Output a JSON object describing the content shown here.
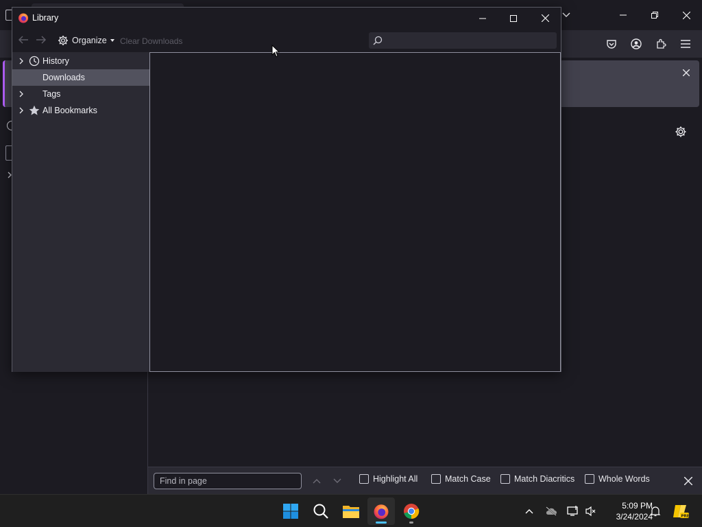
{
  "background_browser": {
    "notice_close_icon": "close-icon",
    "findbar": {
      "placeholder": "Find in page",
      "options": [
        {
          "label": "Highlight All",
          "checked": false
        },
        {
          "label": "Match Case",
          "checked": false
        },
        {
          "label": "Match Diacritics",
          "checked": false
        },
        {
          "label": "Whole Words",
          "checked": false
        }
      ]
    }
  },
  "library": {
    "title": "Library",
    "toolbar": {
      "organize_label": "Organize",
      "clear_label": "Clear Downloads",
      "search_placeholder": ""
    },
    "tree": [
      {
        "label": "History",
        "icon": "clock-icon",
        "expandable": true,
        "selected": false
      },
      {
        "label": "Downloads",
        "icon": "",
        "expandable": false,
        "selected": true
      },
      {
        "label": "Tags",
        "icon": "",
        "expandable": true,
        "selected": false
      },
      {
        "label": "All Bookmarks",
        "icon": "star-icon",
        "expandable": true,
        "selected": false
      }
    ]
  },
  "taskbar": {
    "apps": [
      "windows-start",
      "search",
      "file-explorer",
      "firefox",
      "chrome"
    ],
    "clock_time": "5:09 PM",
    "clock_date": "3/24/2024"
  },
  "colors": {
    "accent": "#0078d4",
    "selection": "#52525e",
    "panel": "#2b2a33",
    "background": "#1c1b22"
  }
}
